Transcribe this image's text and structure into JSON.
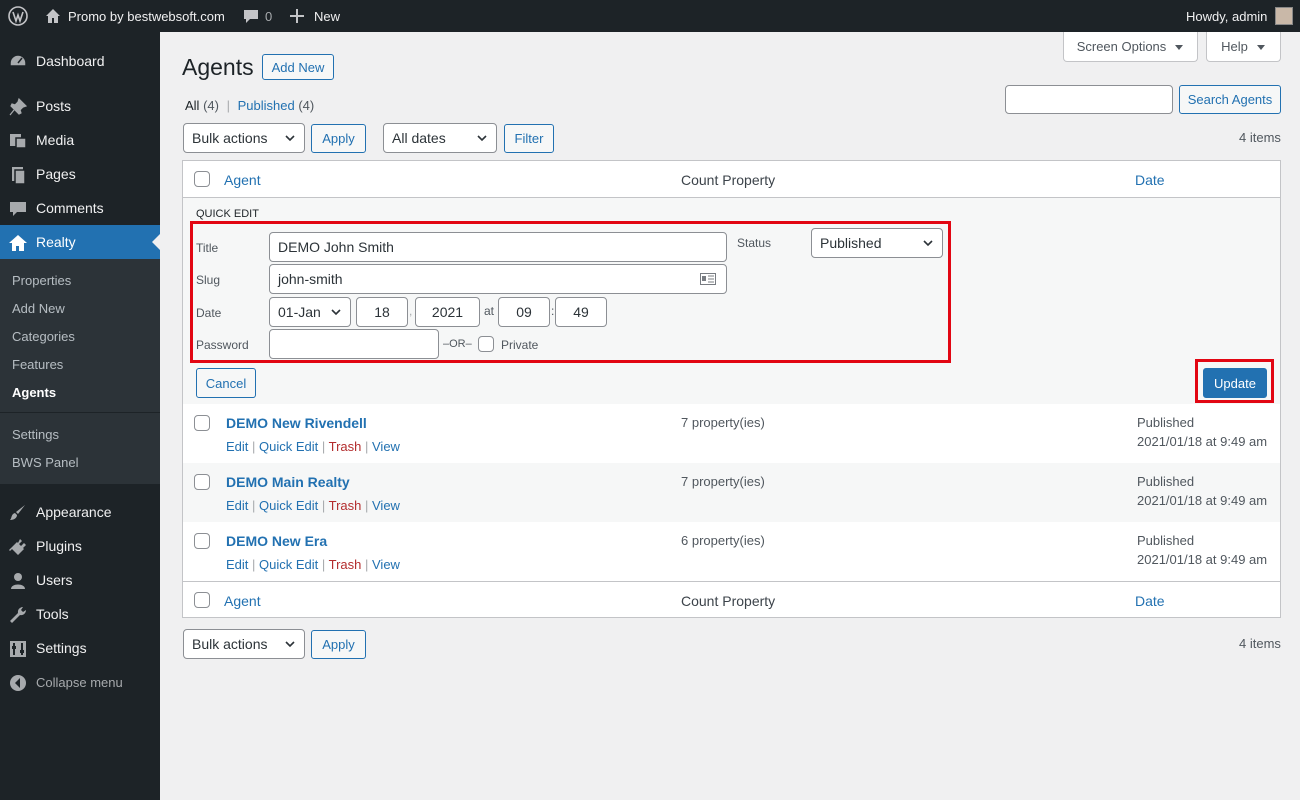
{
  "adminbar": {
    "site_name": "Promo by bestwebsoft.com",
    "comments_count": "0",
    "new_label": "New",
    "howdy": "Howdy, admin"
  },
  "sidebar": {
    "dashboard": "Dashboard",
    "posts": "Posts",
    "media": "Media",
    "pages": "Pages",
    "comments": "Comments",
    "realty": "Realty",
    "submenu": [
      "Properties",
      "Add New",
      "Categories",
      "Features",
      "Agents",
      "Settings",
      "BWS Panel"
    ],
    "appearance": "Appearance",
    "plugins": "Plugins",
    "users": "Users",
    "tools": "Tools",
    "settings": "Settings",
    "collapse": "Collapse menu"
  },
  "header": {
    "title": "Agents",
    "add_new": "Add New",
    "screen_options": "Screen Options",
    "help": "Help"
  },
  "filters": {
    "all_label": "All",
    "all_count": "(4)",
    "published_label": "Published",
    "published_count": "(4)",
    "search_button": "Search Agents",
    "search_value": "",
    "bulk_actions": "Bulk actions",
    "apply": "Apply",
    "all_dates": "All dates",
    "filter": "Filter",
    "items_count": "4 items"
  },
  "table": {
    "col_agent": "Agent",
    "col_count": "Count Property",
    "col_date": "Date",
    "rows": [
      {
        "title": "DEMO New Rivendell",
        "count": "7 property(ies)",
        "status": "Published",
        "date": "2021/01/18 at 9:49 am"
      },
      {
        "title": "DEMO Main Realty",
        "count": "7 property(ies)",
        "status": "Published",
        "date": "2021/01/18 at 9:49 am"
      },
      {
        "title": "DEMO New Era",
        "count": "6 property(ies)",
        "status": "Published",
        "date": "2021/01/18 at 9:49 am"
      }
    ],
    "actions": {
      "edit": "Edit",
      "quick_edit": "Quick Edit",
      "trash": "Trash",
      "view": "View"
    }
  },
  "quick_edit": {
    "heading": "QUICK EDIT",
    "title_label": "Title",
    "title_value": "DEMO John Smith",
    "slug_label": "Slug",
    "slug_value": "john-smith",
    "date_label": "Date",
    "month": "01-Jan",
    "day": "18",
    "comma": ",",
    "year": "2021",
    "at": "at",
    "hour": "09",
    "colon": ":",
    "minute": "49",
    "password_label": "Password",
    "password_value": "",
    "or": "–OR–",
    "private_label": "Private",
    "status_label": "Status",
    "status_value": "Published",
    "cancel": "Cancel",
    "update": "Update"
  },
  "colors": {
    "highlight": "#e20613",
    "accent": "#2271b1",
    "trash": "#b32d2e"
  }
}
